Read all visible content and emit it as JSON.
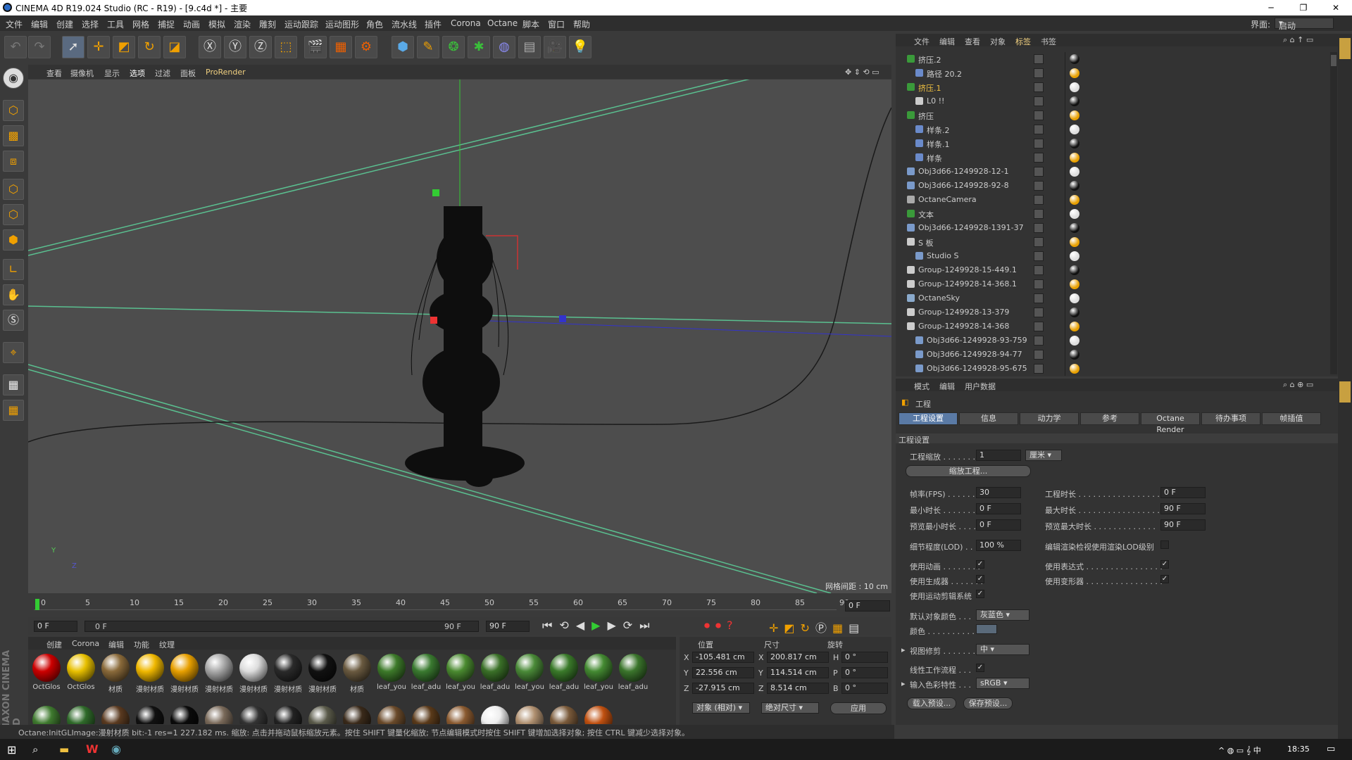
{
  "window": {
    "title": "CINEMA 4D R19.024 Studio (RC - R19) - [9.c4d *] - 主要"
  },
  "menu": [
    "文件",
    "编辑",
    "创建",
    "选择",
    "工具",
    "网格",
    "捕捉",
    "动画",
    "模拟",
    "渲染",
    "雕刻",
    "运动跟踪",
    "运动图形",
    "角色",
    "流水线",
    "插件",
    "Corona",
    "Octane",
    "脚本",
    "窗口",
    "帮助"
  ],
  "layout": {
    "label": "界面:",
    "value": "启动"
  },
  "viewport": {
    "menu": [
      "查看",
      "摄像机",
      "显示",
      "选项",
      "过滤",
      "面板",
      "ProRender"
    ],
    "grid_label": "网格间距 : 10 cm",
    "axis_y": "Y",
    "axis_z": "Z"
  },
  "timeline": {
    "ticks": [
      "0",
      "5",
      "10",
      "15",
      "20",
      "25",
      "30",
      "35",
      "40",
      "45",
      "50",
      "55",
      "60",
      "65",
      "70",
      "75",
      "80",
      "85",
      "90"
    ],
    "end_field": "0 F"
  },
  "transport": {
    "start": "0 F",
    "range_start": "0 F",
    "range_end": "90 F",
    "end": "90 F"
  },
  "materials": {
    "menu": [
      "创建",
      "Corona",
      "编辑",
      "功能",
      "纹理"
    ],
    "row1": [
      {
        "name": "OctGlos",
        "color": "#c00"
      },
      {
        "name": "OctGlos",
        "color": "#e8c000"
      },
      {
        "name": "材质",
        "color": "#8a6a3a"
      },
      {
        "name": "漫射材质",
        "color": "#f0b800"
      },
      {
        "name": "漫射材质",
        "color": "#e8a000"
      },
      {
        "name": "漫射材质",
        "color": "#aaa"
      },
      {
        "name": "漫射材质",
        "color": "#ddd"
      },
      {
        "name": "漫射材质",
        "color": "#2a2a2a"
      },
      {
        "name": "漫射材质",
        "color": "#111"
      },
      {
        "name": "材质",
        "color": "#6a5a40"
      },
      {
        "name": "leaf_you",
        "color": "#3d7a2a"
      },
      {
        "name": "leaf_adu",
        "color": "#3a7a30"
      },
      {
        "name": "leaf_you",
        "color": "#4a8a30"
      },
      {
        "name": "leaf_adu",
        "color": "#3a7028"
      },
      {
        "name": "leaf_you",
        "color": "#4a8a38"
      },
      {
        "name": "leaf_adu",
        "color": "#3a7a2a"
      },
      {
        "name": "leaf_you",
        "color": "#448a32"
      },
      {
        "name": "leaf_adu",
        "color": "#3b752c"
      }
    ],
    "row2": [
      "#3f7a2f",
      "#2f6a2a",
      "#5a3a20",
      "#111",
      "#0a0a0a",
      "#7a6a5a",
      "#333",
      "#222",
      "#5a5a4a",
      "#3a2a1a",
      "#6a4a2a",
      "#5a3a1a",
      "#8a5a30",
      "#eee",
      "#b09070",
      "#7a5a3a",
      "#c05010"
    ]
  },
  "coords": {
    "headers": [
      "位置",
      "尺寸",
      "旋转"
    ],
    "rows": [
      {
        "axis": "X",
        "pos": "-105.481 cm",
        "size_axis": "X",
        "size": "200.817 cm",
        "rot_axis": "H",
        "rot": "0 °"
      },
      {
        "axis": "Y",
        "pos": "22.556 cm",
        "size_axis": "Y",
        "size": "114.514 cm",
        "rot_axis": "P",
        "rot": "0 °"
      },
      {
        "axis": "Z",
        "pos": "-27.915 cm",
        "size_axis": "Z",
        "size": "8.514 cm",
        "rot_axis": "B",
        "rot": "0 °"
      }
    ],
    "mode": "对象 (相对)",
    "size_mode": "绝对尺寸",
    "apply": "应用"
  },
  "status": "Octane:InitGLImage:漫射材质  bit:-1 res=1  227.182 ms.   缩放: 点击并拖动鼠标缩放元素。按住 SHIFT 键量化缩放; 节点编辑模式时按住 SHIFT 键增加选择对象; 按住 CTRL 键减少选择对象。",
  "objects": {
    "menu": [
      "文件",
      "编辑",
      "查看",
      "对象",
      "标签",
      "书签"
    ],
    "items": [
      {
        "name": "挤压.2",
        "indent": 0,
        "icon": "#3a9a3a"
      },
      {
        "name": "路径 20.2",
        "indent": 1,
        "icon": "#6a8aca"
      },
      {
        "name": "挤压.1",
        "indent": 0,
        "icon": "#3a9a3a",
        "hl": true
      },
      {
        "name": "L0 !!",
        "indent": 1,
        "icon": "#ccc"
      },
      {
        "name": "挤压",
        "indent": 0,
        "icon": "#3a9a3a"
      },
      {
        "name": "样条.2",
        "indent": 1,
        "icon": "#6a8aca"
      },
      {
        "name": "样条.1",
        "indent": 1,
        "icon": "#6a8aca"
      },
      {
        "name": "样条",
        "indent": 1,
        "icon": "#6a8aca"
      },
      {
        "name": "Obj3d66-1249928-12-1",
        "indent": 0,
        "icon": "#7a9aca"
      },
      {
        "name": "Obj3d66-1249928-92-8",
        "indent": 0,
        "icon": "#7a9aca"
      },
      {
        "name": "OctaneCamera",
        "indent": 0,
        "icon": "#aaa"
      },
      {
        "name": "文本",
        "indent": 0,
        "icon": "#3a9a3a"
      },
      {
        "name": "Obj3d66-1249928-1391-37",
        "indent": 0,
        "icon": "#7a9aca"
      },
      {
        "name": "S 板",
        "indent": 0,
        "icon": "#ccc"
      },
      {
        "name": "Studio S",
        "indent": 1,
        "icon": "#7a9aca"
      },
      {
        "name": "Group-1249928-15-449.1",
        "indent": 0,
        "icon": "#ccc"
      },
      {
        "name": "Group-1249928-14-368.1",
        "indent": 0,
        "icon": "#ccc"
      },
      {
        "name": "OctaneSky",
        "indent": 0,
        "icon": "#8aaacc"
      },
      {
        "name": "Group-1249928-13-379",
        "indent": 0,
        "icon": "#ccc"
      },
      {
        "name": "Group-1249928-14-368",
        "indent": 0,
        "icon": "#ccc"
      },
      {
        "name": "Obj3d66-1249928-93-759",
        "indent": 1,
        "icon": "#7a9aca"
      },
      {
        "name": "Obj3d66-1249928-94-77",
        "indent": 1,
        "icon": "#7a9aca"
      },
      {
        "name": "Obj3d66-1249928-95-675",
        "indent": 1,
        "icon": "#7a9aca"
      }
    ]
  },
  "attrs": {
    "menu": [
      "模式",
      "编辑",
      "用户数据"
    ],
    "title": "工程",
    "tabs": [
      "工程设置",
      "信息",
      "动力学",
      "参考",
      "Octane Render",
      "待办事项",
      "帧插值"
    ],
    "section": "工程设置",
    "scale_label": "工程缩放 . . . . . . .",
    "scale_value": "1",
    "scale_unit": "厘米",
    "scale_btn": "缩放工程...",
    "fps_label": "帧率(FPS) . . . . . . .",
    "fps": "30",
    "len_label": "工程时长 . . . . . . . . . . . . . . . . .",
    "len": "0 F",
    "min_label": "最小时长 . . . . . . . .",
    "min": "0 F",
    "max_label": "最大时长 . . . . . . . . . . . . . . . . .",
    "max": "90 F",
    "pmin_label": "预览最小时长 . . . . .",
    "pmin": "0 F",
    "pmax_label": "预览最大时长 . . . . . . . . . . . . .",
    "pmax": "90 F",
    "lod_label": "细节程度(LOD) . . . .",
    "lod": "100 %",
    "lod_render_label": "编辑渲染检视使用渲染LOD级别",
    "anim_label": "使用动画 . . . . . . . .",
    "expr_label": "使用表达式 . . . . . . . . . . . . . . . .",
    "gen_label": "使用生成器 . . . . . . .",
    "deform_label": "使用变形器 . . . . . . . . . . . . . . . .",
    "mograph_label": "使用运动剪辑系统",
    "defcolor_label": "默认对象颜色 . . .",
    "defcolor": "灰蓝色",
    "color_label": "颜色 . . . . . . . . . .",
    "clip_label": "视图修剪 . . . . . . .",
    "clip": "中",
    "linear_label": "线性工作流程 . . .",
    "input_label": "输入色彩特性 . . .",
    "input": "sRGB",
    "load_btn": "载入预设...",
    "save_btn": "保存预设..."
  },
  "taskbar": {
    "time": "18:35"
  }
}
